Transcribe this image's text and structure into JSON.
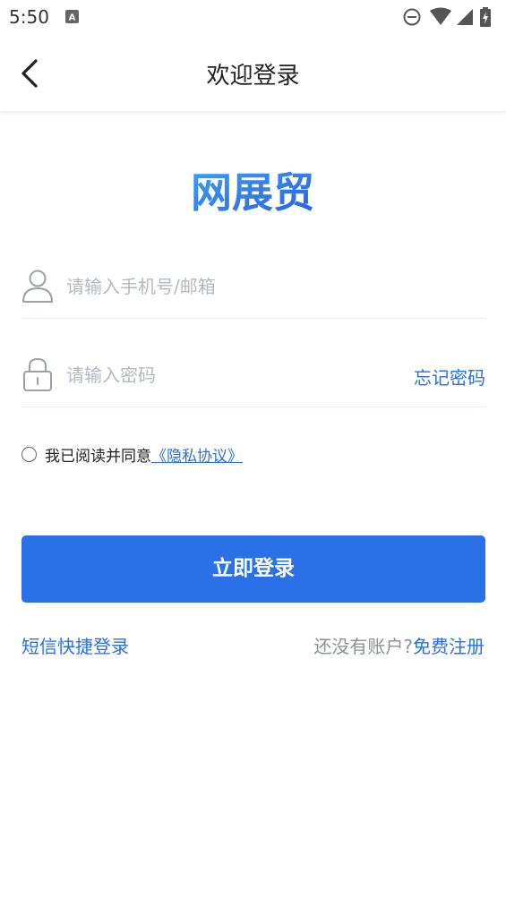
{
  "status_bar": {
    "time": "5:50",
    "icons": [
      "notification-a-icon",
      "do-not-disturb-icon",
      "wifi-icon",
      "signal-icon",
      "battery-icon"
    ]
  },
  "header": {
    "title": "欢迎登录",
    "back_icon": "chevron-left-icon"
  },
  "logo": {
    "text": "网展贸",
    "color": "#2a6ee4"
  },
  "form": {
    "account": {
      "placeholder": "请输入手机号/邮箱",
      "value": "",
      "icon": "user-icon"
    },
    "password": {
      "placeholder": "请输入密码",
      "value": "",
      "icon": "lock-icon",
      "forgot_label": "忘记密码"
    },
    "agreement": {
      "checked": false,
      "text": "我已阅读并同意",
      "link_label": "《隐私协议》"
    }
  },
  "login_button": {
    "label": "立即登录",
    "color": "#2a70e6"
  },
  "footer": {
    "sms_login_label": "短信快捷登录",
    "register_prompt": "还没有账户?",
    "register_label": "免费注册"
  },
  "colors": {
    "accent": "#2a6ee4",
    "placeholder": "#b3b8c1",
    "muted": "#8a8f98"
  }
}
